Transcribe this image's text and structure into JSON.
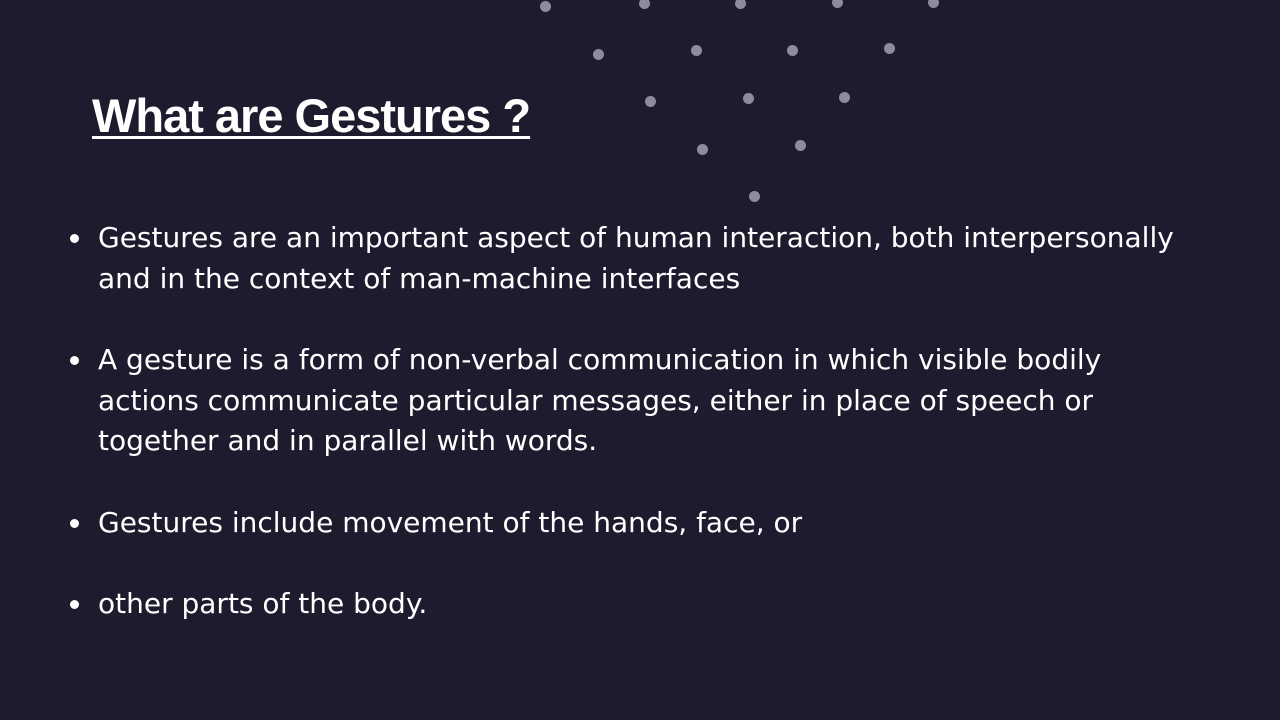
{
  "slide": {
    "title": "What are Gestures ?",
    "bullets": [
      "Gestures are an important aspect of human interaction, both interpersonally and in the context of man-machine interfaces",
      "A gesture is a form of non-verbal communication in which visible bodily actions communicate particular messages, either in place of speech or together and in parallel with words.",
      "Gestures include movement of the hands, face, or",
      "other parts of the body."
    ]
  },
  "colors": {
    "background": "#1d1b2e",
    "text": "#ffffff",
    "dot": "#8e8c9b"
  }
}
